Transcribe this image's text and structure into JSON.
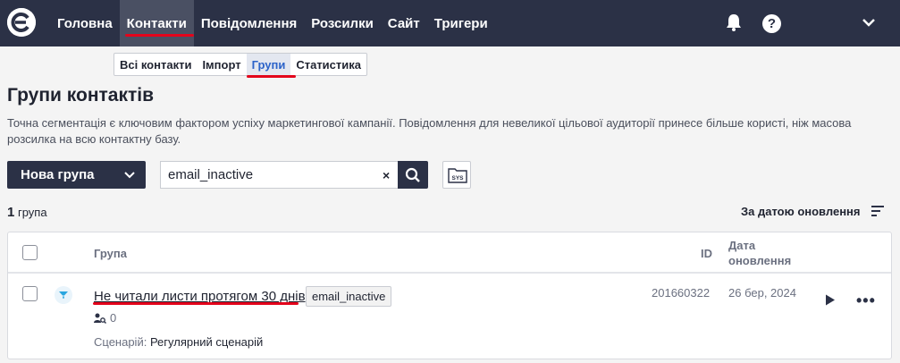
{
  "nav": {
    "items": [
      {
        "label": "Головна"
      },
      {
        "label": "Контакти",
        "active": true
      },
      {
        "label": "Повідомлення"
      },
      {
        "label": "Розсилки"
      },
      {
        "label": "Сайт"
      },
      {
        "label": "Тригери"
      }
    ],
    "icons": [
      "logo-icon",
      "bell-icon",
      "help-icon",
      "chevron-down-icon"
    ],
    "help_glyph": "?"
  },
  "subtabs": [
    {
      "label": "Всі контакти"
    },
    {
      "label": "Імпорт"
    },
    {
      "label": "Групи",
      "active": true
    },
    {
      "label": "Статистика"
    }
  ],
  "page": {
    "title": "Групи контактів",
    "description": "Точна сегментація є ключовим фактором успіху маркетингової кампанії. Повідомлення для невеликої цільової аудиторії принесе більше користі, ніж масова розсилка на всю контактну базу."
  },
  "toolbar": {
    "new_group_label": "Нова група",
    "search_value": "email_inactive",
    "clear_glyph": "×"
  },
  "summary": {
    "count": "1",
    "count_label": "група",
    "sort_label": "За датою оновлення"
  },
  "table": {
    "headers": {
      "group": "Група",
      "id": "ID",
      "date_line1": "Дата",
      "date_line2": "оновлення"
    },
    "rows": [
      {
        "name": "Не читали листи протягом 30 днів",
        "tag": "email_inactive",
        "members": "0",
        "scenario_label": "Сценарій:",
        "scenario_value": "Регулярний сценарій",
        "id": "201660322",
        "date": "26 бер, 2024"
      }
    ],
    "more_glyph": "•••"
  },
  "colors": {
    "topbar": "#2b3146",
    "accent_underline": "#e3041b",
    "active_subtab_text": "#2c63c9"
  }
}
